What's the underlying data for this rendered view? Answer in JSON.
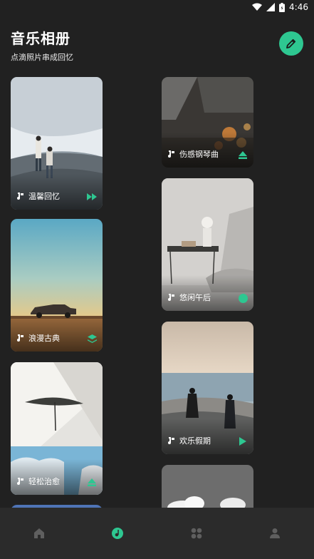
{
  "status_bar": {
    "time": "4:46",
    "icons": [
      "wifi-icon",
      "signal-icon",
      "battery-icon"
    ]
  },
  "header": {
    "title": "音乐相册",
    "subtitle": "点滴照片串成回忆",
    "edit_icon": "pencil-icon"
  },
  "colors": {
    "accent": "#2ec791",
    "background": "#212121",
    "nav_background": "#2b2b2b",
    "nav_inactive": "#5f5f5f"
  },
  "cards": [
    {
      "label": "温馨回忆",
      "action_icon": "fast-forward-icon"
    },
    {
      "label": "浪漫古典",
      "action_icon": "layers-icon"
    },
    {
      "label": "轻松治愈",
      "action_icon": "eject-icon"
    },
    {
      "label": "伤感钢琴曲",
      "action_icon": "eject-icon"
    },
    {
      "label": "悠闲午后",
      "action_icon": "circle-icon"
    },
    {
      "label": "欢乐假期",
      "action_icon": "play-icon"
    }
  ],
  "bottom_nav": {
    "items": [
      {
        "name": "home",
        "icon": "home-icon",
        "active": false
      },
      {
        "name": "music",
        "icon": "music-icon",
        "active": true
      },
      {
        "name": "grid",
        "icon": "grid-icon",
        "active": false
      },
      {
        "name": "profile",
        "icon": "person-icon",
        "active": false
      }
    ]
  }
}
